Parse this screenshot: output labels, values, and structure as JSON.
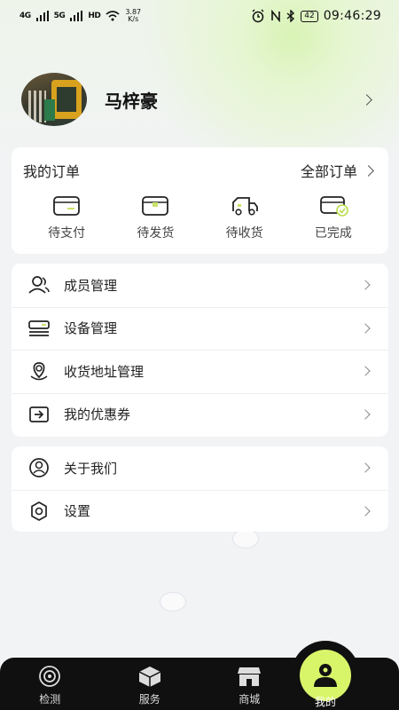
{
  "status_bar": {
    "signal1": "4G",
    "signal2": "5G",
    "hd": "HD",
    "speed_value": "3.87",
    "speed_unit": "K/s",
    "battery": "42",
    "time": "09:46:29"
  },
  "profile": {
    "name": "马梓豪"
  },
  "orders": {
    "title": "我的订单",
    "all_label": "全部订单",
    "items": [
      {
        "label": "待支付",
        "icon": "wallet-icon"
      },
      {
        "label": "待发货",
        "icon": "package-icon"
      },
      {
        "label": "待收货",
        "icon": "truck-icon"
      },
      {
        "label": "已完成",
        "icon": "card-check-icon"
      }
    ]
  },
  "menu_group1": [
    {
      "label": "成员管理",
      "icon": "members-icon"
    },
    {
      "label": "设备管理",
      "icon": "device-icon"
    },
    {
      "label": "收货地址管理",
      "icon": "location-icon"
    },
    {
      "label": "我的优惠券",
      "icon": "coupon-icon"
    }
  ],
  "menu_group2": [
    {
      "label": "关于我们",
      "icon": "user-circle-icon"
    },
    {
      "label": "设置",
      "icon": "settings-icon"
    }
  ],
  "tabbar": {
    "tabs": [
      {
        "label": "检测",
        "icon": "detect-icon"
      },
      {
        "label": "服务",
        "icon": "box-icon"
      },
      {
        "label": "商城",
        "icon": "store-icon"
      },
      {
        "label": "我的",
        "icon": "person-icon"
      }
    ],
    "active_color": "#d8f56a"
  }
}
